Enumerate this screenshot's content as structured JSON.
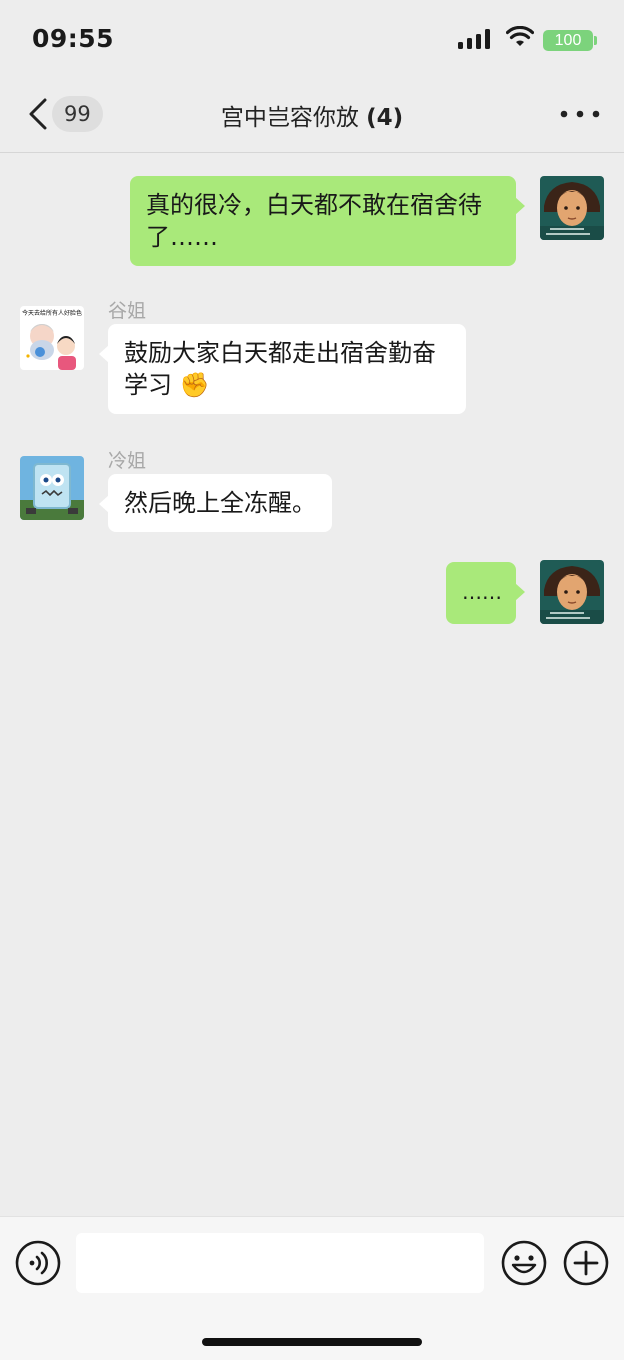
{
  "status_bar": {
    "time": "09:55",
    "battery": "100"
  },
  "nav": {
    "unread_count": "99",
    "title": "宫中岂容你放",
    "member_count": "(4)"
  },
  "messages": [
    {
      "direction": "out",
      "avatar": "man-hands-behind-head-avatar",
      "text": "真的很冷，白天都不敢在宿舍待了……"
    },
    {
      "direction": "in",
      "sender": "谷姐",
      "avatar": "cartoon-girl-avatar",
      "text": "鼓励大家白天都走出宿舍勤奋学习",
      "emoji": "✊",
      "avatar_caption": "今天去给所有人好脸色"
    },
    {
      "direction": "in",
      "sender": "冷姐",
      "avatar": "frozen-sponge-avatar",
      "text": "然后晚上全冻醒。"
    },
    {
      "direction": "out",
      "avatar": "man-hands-behind-head-avatar",
      "text": "……"
    }
  ],
  "input": {
    "value": "",
    "placeholder": ""
  },
  "icons": [
    "back-icon",
    "more-icon",
    "voice-icon",
    "emoji-icon",
    "plus-icon"
  ],
  "colors": {
    "background": "#ededed",
    "outgoing_bubble": "#a9e97a",
    "incoming_bubble": "#ffffff",
    "battery": "#7cd37c"
  }
}
